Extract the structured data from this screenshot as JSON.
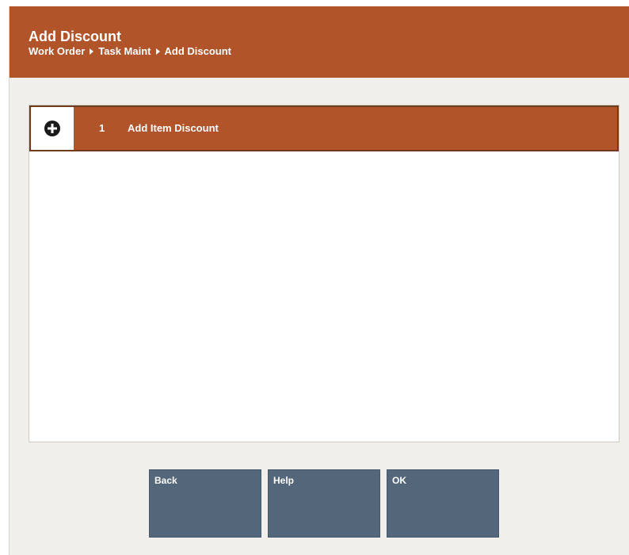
{
  "header": {
    "title": "Add Discount",
    "breadcrumb": [
      "Work Order",
      "Task Maint",
      "Add Discount"
    ]
  },
  "list": {
    "items": [
      {
        "icon": "plus-circle-icon",
        "index": "1",
        "label": "Add Item Discount"
      }
    ]
  },
  "buttons": {
    "back": "Back",
    "help": "Help",
    "ok": "OK"
  },
  "colors": {
    "header_bg": "#b2542a",
    "selected_row_bg": "#b2542a",
    "button_bg": "#53667a",
    "panel_bg": "#f1efeb"
  }
}
